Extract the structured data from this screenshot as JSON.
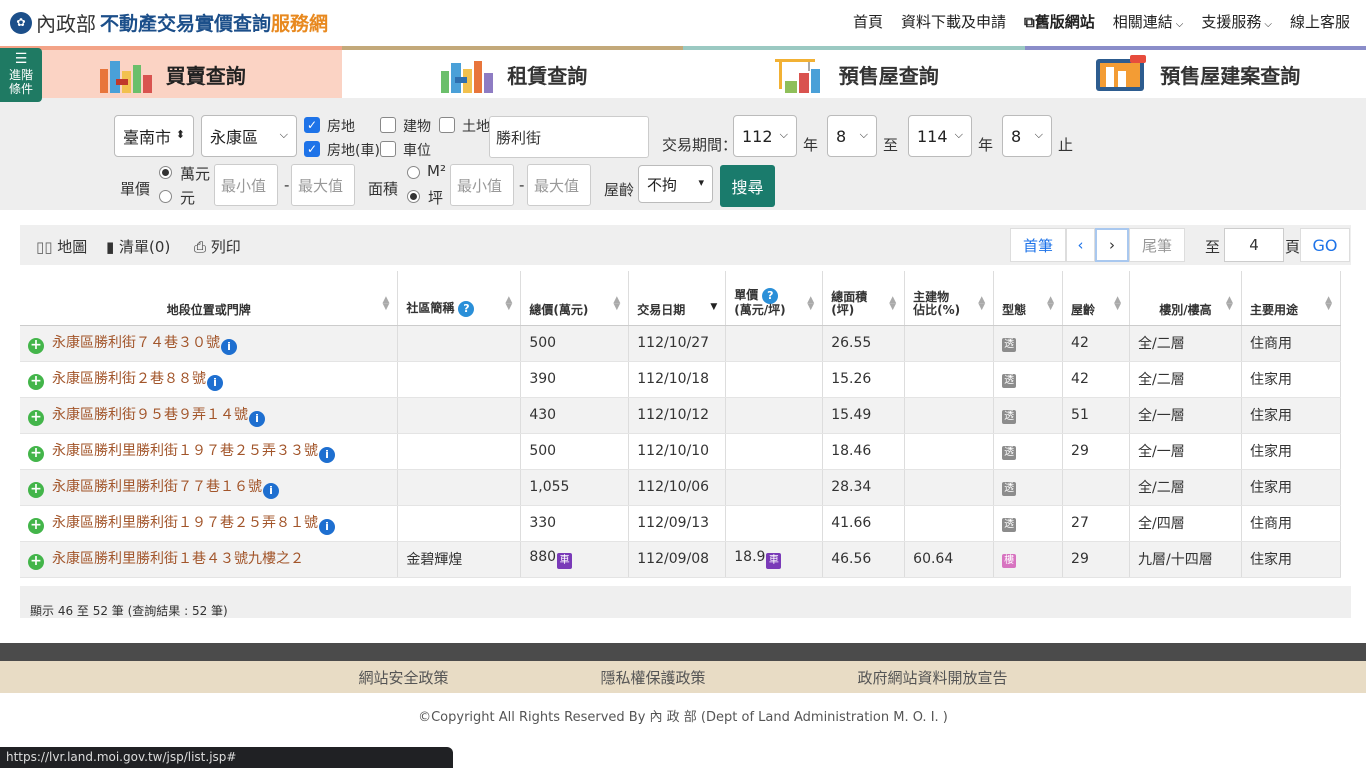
{
  "header": {
    "logo_moi": "內政部",
    "logo_title": "不動產交易實價查詢",
    "logo_suffix": "服務網",
    "nav": [
      "首頁",
      "資料下載及申請",
      "舊版網站",
      "相關連結",
      "支援服務",
      "線上客服"
    ]
  },
  "sidebar_button": {
    "label_line1": "進階",
    "label_line2": "條件"
  },
  "tabs": [
    {
      "label": "買賣查詢",
      "active": true
    },
    {
      "label": "租賃查詢",
      "active": false
    },
    {
      "label": "預售屋查詢",
      "active": false
    },
    {
      "label": "預售屋建案查詢",
      "active": false
    }
  ],
  "filter": {
    "city": "臺南市",
    "district": "永康區",
    "type_land_building": "房地",
    "type_land_building_car": "房地(車)",
    "type_building": "建物",
    "type_parking": "車位",
    "type_land": "土地",
    "street": "勝利街",
    "period_label": "交易期間：",
    "year_from": "112",
    "month_from": "8",
    "year_to": "114",
    "month_to": "8",
    "unit_year": "年",
    "unit_to": "至",
    "unit_end": "止",
    "unit_price_label": "單價",
    "unit_price_wan": "萬元",
    "unit_price_yuan": "元",
    "min_placeholder": "最小值",
    "max_placeholder": "最大值",
    "area_label": "面積",
    "area_m2": "M²",
    "area_ping": "坪",
    "age_label": "屋齡",
    "age_value": "不拘",
    "search_label": "搜尋"
  },
  "toolbar": {
    "map": "地圖",
    "list": "清單(0)",
    "print": "列印",
    "first": "首筆",
    "prev": "‹",
    "next": "›",
    "last": "尾筆",
    "goto_prefix": "至",
    "page_value": "4",
    "goto_suffix": "頁",
    "go": "GO"
  },
  "table": {
    "headers": [
      "地段位置或門牌",
      "社區簡稱",
      "總價(萬元)",
      "交易日期",
      "單價",
      "(萬元/坪)",
      "總面積",
      "(坪)",
      "主建物",
      "佔比(%)",
      "型態",
      "屋齡",
      "樓別/樓高",
      "主要用途"
    ],
    "rows": [
      {
        "address": "永康區勝利街７４巷３０號",
        "community": "",
        "total": "500",
        "date": "112/10/27",
        "unit": "",
        "area": "26.55",
        "ratio": "",
        "type": "透",
        "age": "42",
        "floor": "全/二層",
        "use": "住商用"
      },
      {
        "address": "永康區勝利街２巷８８號",
        "community": "",
        "total": "390",
        "date": "112/10/18",
        "unit": "",
        "area": "15.26",
        "ratio": "",
        "type": "透",
        "age": "42",
        "floor": "全/二層",
        "use": "住家用"
      },
      {
        "address": "永康區勝利街９５巷９弄１４號",
        "community": "",
        "total": "430",
        "date": "112/10/12",
        "unit": "",
        "area": "15.49",
        "ratio": "",
        "type": "透",
        "age": "51",
        "floor": "全/一層",
        "use": "住家用"
      },
      {
        "address": "永康區勝利里勝利街１９７巷２５弄３３號",
        "community": "",
        "total": "500",
        "date": "112/10/10",
        "unit": "",
        "area": "18.46",
        "ratio": "",
        "type": "透",
        "age": "29",
        "floor": "全/一層",
        "use": "住家用"
      },
      {
        "address": "永康區勝利里勝利街７７巷１６號",
        "community": "",
        "total": "1,055",
        "date": "112/10/06",
        "unit": "",
        "area": "28.34",
        "ratio": "",
        "type": "透",
        "age": "",
        "floor": "全/二層",
        "use": "住家用"
      },
      {
        "address": "永康區勝利里勝利街１９７巷２５弄８１號",
        "community": "",
        "total": "330",
        "date": "112/09/13",
        "unit": "",
        "area": "41.66",
        "ratio": "",
        "type": "透",
        "age": "27",
        "floor": "全/四層",
        "use": "住商用"
      },
      {
        "address": "永康區勝利里勝利街１巷４３號九樓之２",
        "community": "金碧輝煌",
        "total": "880",
        "date": "112/09/08",
        "unit": "18.9",
        "area": "46.56",
        "ratio": "60.64",
        "type": "樓",
        "age": "29",
        "floor": "九層/十四層",
        "use": "住家用"
      }
    ],
    "car_badge": "車",
    "info_glyph": "i",
    "question_glyph": "?"
  },
  "summary": "顯示 46 至 52 筆 (查詢結果 : 52 筆)",
  "footer": {
    "links": [
      "網站安全政策",
      "隱私權保護政策",
      "政府網站資料開放宣告"
    ],
    "copyright": "©Copyright All Rights Reserved By 內 政 部 (Dept of Land Administration M. O. I. )"
  },
  "status_url": "https://lvr.land.moi.gov.tw/jsp/list.jsp#",
  "colors": {
    "brand_blue": "#1c4f8a",
    "brand_orange": "#e8891f",
    "accent_green": "#1a7b6c",
    "address_brown": "#a2552a"
  }
}
